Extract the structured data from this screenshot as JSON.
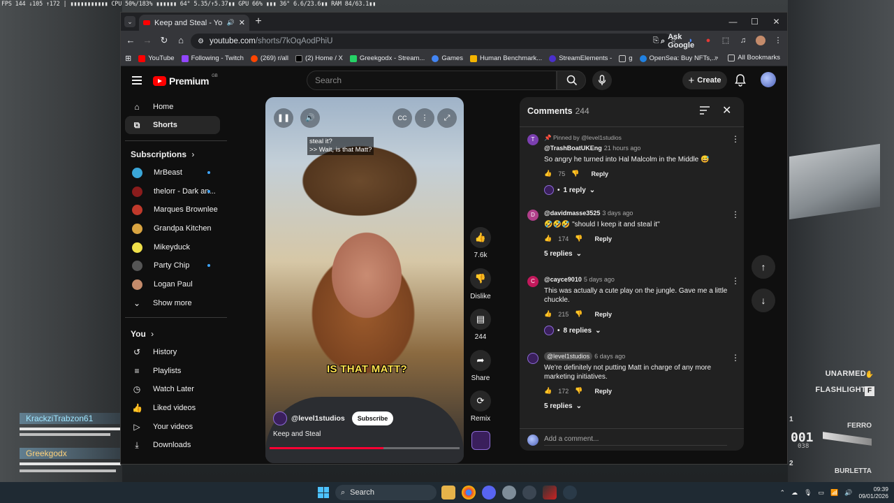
{
  "overlay": {
    "stats": "FPS 144 ↓105 ↑172 | ▮▮▮▮▮▮▮▮▮▮▮ CPU 50%/183% ▮▮▮▮▮▮ 64° 5.35/↑5.37▮▮ GPU 66% ▮▮▮ 36° 6.6/23.6▮▮ RAM 84/63.1▮▮"
  },
  "game_hud": {
    "players": [
      "KrackziTrabzon61",
      "Greekgodx"
    ],
    "unarmed_label": "UNARMED",
    "flashlight_label": "FLASHLIGHT",
    "flashlight_key": "F",
    "slot1": "1",
    "slot2": "2",
    "weapon1": "FERRO",
    "weapon2": "BURLETTA",
    "ammo": "001",
    "ammo_reserve": "038"
  },
  "browser": {
    "tab_title": "Keep and Steal - YouTube",
    "url_host": "youtube.com",
    "url_path": "/shorts/7kOqAodPhiU",
    "ask_google": "Ask Google",
    "bookmarks": [
      {
        "label": "YouTube",
        "color": "#ff0000"
      },
      {
        "label": "Following - Twitch",
        "color": "#9146ff"
      },
      {
        "label": "(269) r/all",
        "color": "#ff4500"
      },
      {
        "label": "(2) Home / X",
        "color": "#000000"
      },
      {
        "label": "Greekgodx - Stream...",
        "color": "#25d366"
      },
      {
        "label": "Games",
        "color": "#4285f4"
      },
      {
        "label": "Human Benchmark...",
        "color": "#f4b400"
      },
      {
        "label": "StreamElements -",
        "color": "#4a2fcc"
      },
      {
        "label": "g",
        "color": "#888888"
      },
      {
        "label": "OpenSea: Buy NFTs,...",
        "color": "#2081e2"
      }
    ],
    "all_bookmarks": "All Bookmarks"
  },
  "youtube": {
    "logo_text": "Premium",
    "logo_region": "GB",
    "search_placeholder": "Search",
    "create_label": "Create",
    "nav": [
      {
        "label": "Home",
        "icon": "home-icon"
      },
      {
        "label": "Shorts",
        "icon": "shorts-icon"
      }
    ],
    "subscriptions_heading": "Subscriptions",
    "subscriptions": [
      {
        "name": "MrBeast",
        "color": "#3aa6d8",
        "dot": true
      },
      {
        "name": "thelorr - Dark an...",
        "color": "#8a1c1c",
        "dot": true
      },
      {
        "name": "Marques Brownlee",
        "color": "#c0392b",
        "dot": false
      },
      {
        "name": "Grandpa Kitchen",
        "color": "#d9a441",
        "dot": false
      },
      {
        "name": "Mikeyduck",
        "color": "#f0e04a",
        "dot": false
      },
      {
        "name": "Party Chip",
        "color": "#555555",
        "dot": true
      },
      {
        "name": "Logan Paul",
        "color": "#c48b6b",
        "dot": false
      }
    ],
    "show_more": "Show more",
    "you_heading": "You",
    "you_items": [
      {
        "label": "History",
        "icon": "history-icon"
      },
      {
        "label": "Playlists",
        "icon": "playlists-icon"
      },
      {
        "label": "Watch Later",
        "icon": "watch-later-icon"
      },
      {
        "label": "Liked videos",
        "icon": "like-icon"
      },
      {
        "label": "Your videos",
        "icon": "your-videos-icon"
      },
      {
        "label": "Downloads",
        "icon": "download-icon"
      }
    ],
    "short": {
      "caption_line1": "steal it?",
      "caption_line2": ">> Wait, is that Matt?",
      "burned_subtitle": "IS THAT MATT?",
      "channel": "@level1studios",
      "subscribe": "Subscribe",
      "title": "Keep and Steal",
      "progress": 0.6
    },
    "actions": {
      "likes": "7.6k",
      "dislike": "Dislike",
      "comments": "244",
      "share": "Share",
      "remix": "Remix"
    },
    "comments_panel": {
      "title": "Comments",
      "count": "244",
      "reply_label": "Reply",
      "add_placeholder": "Add a comment...",
      "items": [
        {
          "pinned": "Pinned by @level1studios",
          "author": "@TrashBoatUKEng",
          "time": "21 hours ago",
          "text": "So angry he turned into Hal Malcolm in the Middle 😅",
          "likes": "75",
          "replies": "1 reply",
          "avatar_letter": "T",
          "avatar_color": "#7b3fb0"
        },
        {
          "author": "@davidmasse3525",
          "time": "3 days ago",
          "text": "🤣🤣🤣 \"should I keep it and steal it\"",
          "likes": "174",
          "replies": "5 replies",
          "avatar_letter": "D",
          "avatar_color": "#b03f8a"
        },
        {
          "author": "@cayce9010",
          "time": "5 days ago",
          "text": "This was actually a cute play on the jungle. Gave me a little chuckle.",
          "likes": "215",
          "replies": "8 replies",
          "avatar_letter": "C",
          "avatar_color": "#c2185b"
        },
        {
          "author": "@level1studios",
          "time": "6 days ago",
          "text": "We're definitely not putting Matt in charge of any more marketing initiatives.",
          "likes": "172",
          "replies": "5 replies",
          "avatar_letter": "",
          "avatar_color": "#3a1f5c"
        }
      ]
    }
  },
  "taskbar": {
    "search_label": "Search",
    "time": "09:39",
    "date": "09/01/2026"
  }
}
